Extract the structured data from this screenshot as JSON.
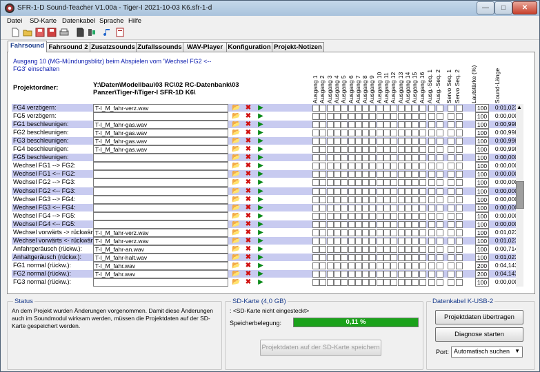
{
  "window": {
    "title": "SFR-1-D Sound-Teacher V1.00a - Tiger-I 2021-10-03 K6.sfr-1-d"
  },
  "menu": [
    "Datei",
    "SD-Karte",
    "Datenkabel",
    "Sprache",
    "Hilfe"
  ],
  "tabs": [
    "Fahrsound",
    "Fahrsound 2",
    "Zusatzsounds",
    "Zufallssounds",
    "WAV-Player",
    "Konfiguration",
    "Projekt-Notizen"
  ],
  "info": {
    "text": "Ausgang 10 (MG-Mündungsblitz) beim Abspielen vom 'Wechsel FG2 <-- FG3' einschalten"
  },
  "project": {
    "label": "Projektordner:",
    "path": "Y:\\Daten\\Modellbau\\03 RC\\02 RC-Datenbank\\03 Panzer\\Tiger-I\\Tiger-I SFR-1D K6\\"
  },
  "columns": {
    "outputs": [
      "Ausgang 1",
      "Ausgang 2",
      "Ausgang 3",
      "Ausgang 4",
      "Ausgang 5",
      "Ausgang 6",
      "Ausgang 7",
      "Ausgang 8",
      "Ausgang 9",
      "Ausgang 10",
      "Ausgang 11",
      "Ausgang 12",
      "Ausgang 13",
      "Ausgang 14",
      "Ausgang 15",
      "Ausgang 16"
    ],
    "seq": [
      "Ausg.-Seq. 1",
      "Ausg.-Seq. 2"
    ],
    "servo": [
      "Servo Seq. 1",
      "Servo Seq. 2"
    ],
    "volume": "Lautstärke (%)",
    "length": "Sound-Länge"
  },
  "rows": [
    {
      "label": "FG4 verzögern:",
      "file": "T-I_M_fahr-verz.wav",
      "volume": "100",
      "length": "0:01,023"
    },
    {
      "label": "FG5 verzögern:",
      "file": "",
      "volume": "100",
      "length": "0:00,000"
    },
    {
      "label": "FG1 beschleunigen:",
      "file": "T-I_M_fahr-gas.wav",
      "volume": "100",
      "length": "0:00,998"
    },
    {
      "label": "FG2 beschleunigen:",
      "file": "T-I_M_fahr-gas.wav",
      "volume": "100",
      "length": "0:00,998"
    },
    {
      "label": "FG3 beschleunigen:",
      "file": "T-I_M_fahr-gas.wav",
      "volume": "100",
      "length": "0:00,998"
    },
    {
      "label": "FG4 beschleunigen:",
      "file": "T-I_M_fahr-gas.wav",
      "volume": "100",
      "length": "0:00,998"
    },
    {
      "label": "FG5 beschleunigen:",
      "file": "",
      "volume": "100",
      "length": "0:00,000"
    },
    {
      "label": "Wechsel FG1 --> FG2:",
      "file": "",
      "volume": "100",
      "length": "0:00,000"
    },
    {
      "label": "Wechsel FG1 <-- FG2:",
      "file": "",
      "volume": "100",
      "length": "0:00,000"
    },
    {
      "label": "Wechsel FG2 --> FG3:",
      "file": "",
      "volume": "100",
      "length": "0:00,000"
    },
    {
      "label": "Wechsel FG2 <-- FG3:",
      "file": "",
      "volume": "100",
      "length": "0:00,000"
    },
    {
      "label": "Wechsel FG3 --> FG4:",
      "file": "",
      "volume": "100",
      "length": "0:00,000"
    },
    {
      "label": "Wechsel FG3 <-- FG4:",
      "file": "",
      "volume": "100",
      "length": "0:00,000"
    },
    {
      "label": "Wechsel FG4 --> FG5:",
      "file": "",
      "volume": "100",
      "length": "0:00,000"
    },
    {
      "label": "Wechsel FG4 <-- FG5:",
      "file": "",
      "volume": "100",
      "length": "0:00,000"
    },
    {
      "label": "Wechsel vorwärts -> rückwärts",
      "file": "T-I_M_fahr-verz.wav",
      "volume": "100",
      "length": "0:01,023"
    },
    {
      "label": "Wechsel vorwärts <- rückwärts",
      "file": "T-I_M_fahr-verz.wav",
      "volume": "100",
      "length": "0:01,023"
    },
    {
      "label": "Anfahrgeräusch (rückw.):",
      "file": "T-I_M_fahr-an.wav",
      "volume": "100",
      "length": "0:00,714"
    },
    {
      "label": "Anhaltgeräusch (rückw.):",
      "file": "T-I_M_fahr-halt.wav",
      "volume": "100",
      "length": "0:01,023"
    },
    {
      "label": "FG1 normal (rückw.):",
      "file": "T-I_M_fahr.wav",
      "volume": "200",
      "length": "0:04,143"
    },
    {
      "label": "FG2 normal (rückw.):",
      "file": "T-I_M_fahr.wav",
      "volume": "200",
      "length": "0:04,143"
    },
    {
      "label": "FG3 normal (rückw.):",
      "file": "",
      "volume": "100",
      "length": "0:00,000"
    }
  ],
  "status": {
    "title": "Status",
    "text": "An dem Projekt wurden Änderungen vorgenommen. Damit diese Änderungen auch im Soundmodul wirksam werden, müssen die Projektdaten auf der SD-Karte gespeichert werden."
  },
  "sd": {
    "title": "SD-Karte (4,0 GB)",
    "card_status": ": <SD-Karte nicht eingesteckt>",
    "mem_label": "Speicherbelegung:",
    "mem_value": "0,11 %",
    "mem_fraction": 0.0011,
    "save_button": "Projektdaten auf der SD-Karte speichern"
  },
  "cable": {
    "title": "Datenkabel K-USB-2",
    "transfer_button": "Projektdaten übertragen",
    "diag_button": "Diagnose starten",
    "port_label": "Port:",
    "port_value": "Automatisch suchen"
  },
  "colors": {
    "row_highlight": "#c8cbf0",
    "tab_active_text": "#1a3c8c",
    "info_text": "#1020b0",
    "progress": "#1ba21b"
  }
}
